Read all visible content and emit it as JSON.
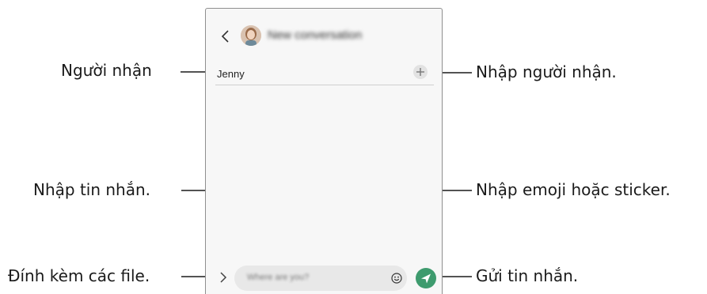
{
  "header": {
    "title": "New conversation"
  },
  "recipient": {
    "value": "Jenny"
  },
  "composer": {
    "placeholder": "Where are you?"
  },
  "callouts": {
    "recipient_label": "Người nhận",
    "add_recipient": "Nhập người nhận.",
    "message_input": "Nhập tin nhắn.",
    "emoji_sticker": "Nhập emoji hoặc sticker.",
    "attach_files": "Đính kèm các file.",
    "send_message": "Gửi tin nhắn."
  },
  "colors": {
    "send_button": "#3e9b6e",
    "phone_background": "#f7f7f7",
    "input_background": "#e8e8e8"
  },
  "icons": {
    "back": "chevron-left-icon",
    "add": "plus-icon",
    "expand": "chevron-right-icon",
    "emoji": "smiley-icon",
    "send": "paper-plane-icon"
  }
}
